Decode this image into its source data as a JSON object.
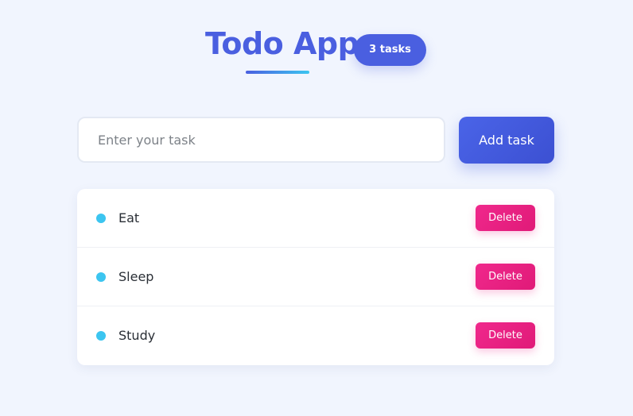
{
  "header": {
    "title": "Todo App",
    "task_count_badge": "3 tasks"
  },
  "form": {
    "task_input_value": "",
    "task_input_placeholder": "Enter your task",
    "add_button_label": "Add task"
  },
  "tasks": [
    {
      "text": "Eat",
      "delete_label": "Delete"
    },
    {
      "text": "Sleep",
      "delete_label": "Delete"
    },
    {
      "text": "Study",
      "delete_label": "Delete"
    }
  ],
  "colors": {
    "accent": "#4a5fe0",
    "dot": "#3cc5f0",
    "delete": "#f0288c",
    "background": "#f1f5fe"
  }
}
